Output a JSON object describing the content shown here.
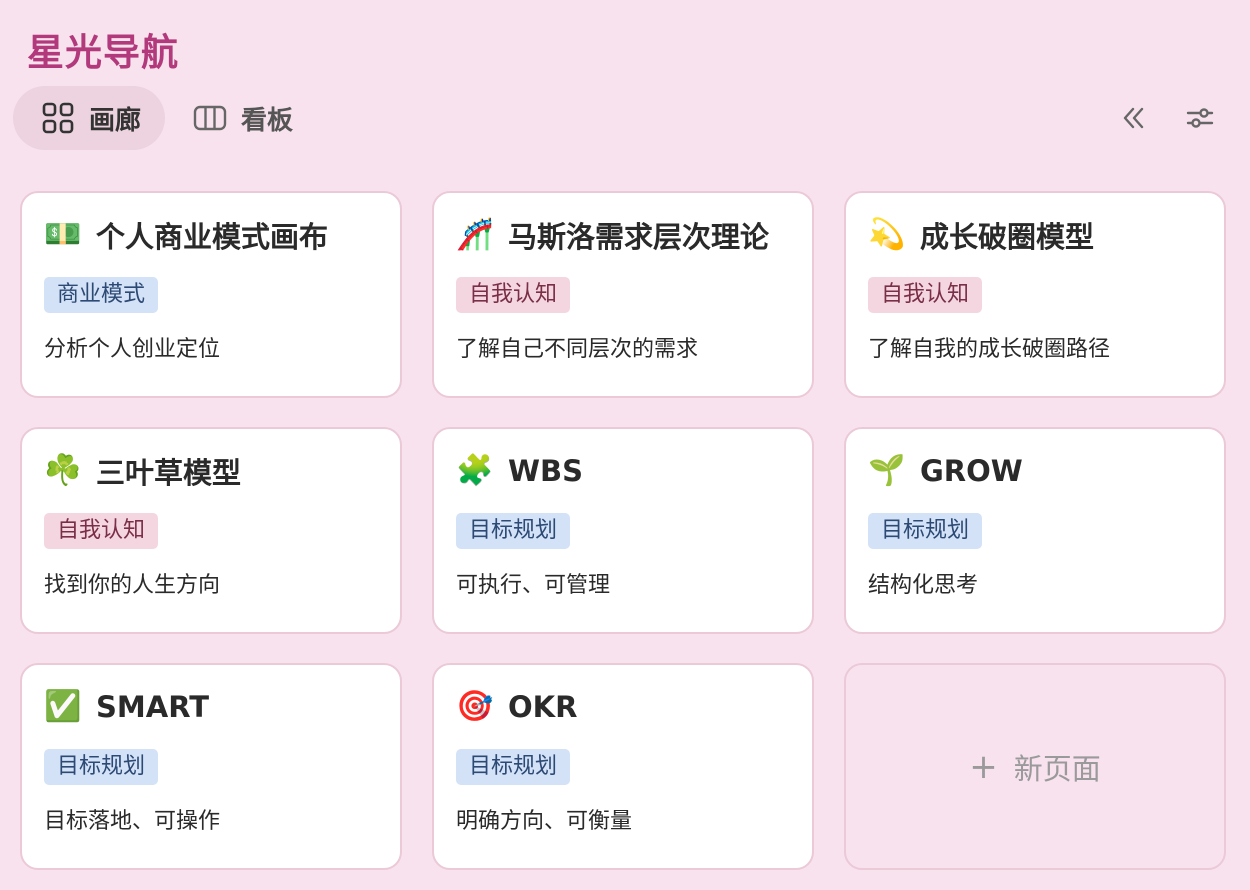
{
  "app": {
    "title": "星光导航"
  },
  "views": [
    {
      "label": "画廊",
      "icon": "grid-icon",
      "active": true
    },
    {
      "label": "看板",
      "icon": "board-icon",
      "active": false
    }
  ],
  "toolbar": {
    "collapse_icon": "double-chevron-left-icon",
    "settings_icon": "sliders-icon"
  },
  "cards": [
    {
      "icon": "💵",
      "title": "个人商业模式画布",
      "tag": "商业模式",
      "tag_color": "blue",
      "desc": "分析个人创业定位"
    },
    {
      "icon": "🎢",
      "title": "马斯洛需求层次理论",
      "tag": "自我认知",
      "tag_color": "pink",
      "desc": "了解自己不同层次的需求"
    },
    {
      "icon": "💫",
      "title": "成长破圈模型",
      "tag": "自我认知",
      "tag_color": "pink",
      "desc": "了解自我的成长破圈路径"
    },
    {
      "icon": "☘️",
      "title": "三叶草模型",
      "tag": "自我认知",
      "tag_color": "pink",
      "desc": "找到你的人生方向"
    },
    {
      "icon": "🧩",
      "title": "WBS",
      "tag": "目标规划",
      "tag_color": "blue",
      "desc": "可执行、可管理"
    },
    {
      "icon": "🌱",
      "title": "GROW",
      "tag": "目标规划",
      "tag_color": "blue",
      "desc": "结构化思考"
    },
    {
      "icon": "✅",
      "title": "SMART",
      "tag": "目标规划",
      "tag_color": "blue",
      "desc": "目标落地、可操作"
    },
    {
      "icon": "🎯",
      "title": "OKR",
      "tag": "目标规划",
      "tag_color": "blue",
      "desc": "明确方向、可衡量"
    }
  ],
  "new_page": {
    "plus": "+",
    "label": "新页面"
  },
  "colors": {
    "background": "#f8e2ee",
    "title": "#b23a7c",
    "tag_blue": "#d3e2f7",
    "tag_pink": "#f4d6e0"
  }
}
